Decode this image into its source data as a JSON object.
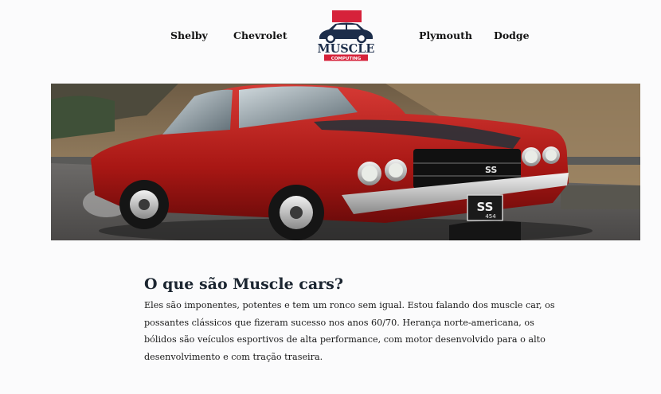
{
  "nav": {
    "links": [
      "Shelby",
      "Chevrolet",
      "Plymouth",
      "Dodge"
    ]
  },
  "logo": {
    "title": "MUSCLE",
    "subtitle": "COMPUTING",
    "colors": {
      "navy": "#1c2d4a",
      "red": "#d6223a"
    }
  },
  "hero": {
    "image": "red-chevelle-ss-car",
    "badge": "SS",
    "plate_top": "SS",
    "plate_bottom": "454"
  },
  "section": {
    "title": "O que são Muscle cars?",
    "body": "Eles são imponentes, potentes e tem um ronco sem igual. Estou falando dos muscle car, os possantes clássicos que fizeram sucesso nos anos 60/70. Herança norte-americana, os bólidos são veículos esportivos de alta performance, com motor desenvolvido para o alto desenvolvimento e com tração traseira."
  }
}
